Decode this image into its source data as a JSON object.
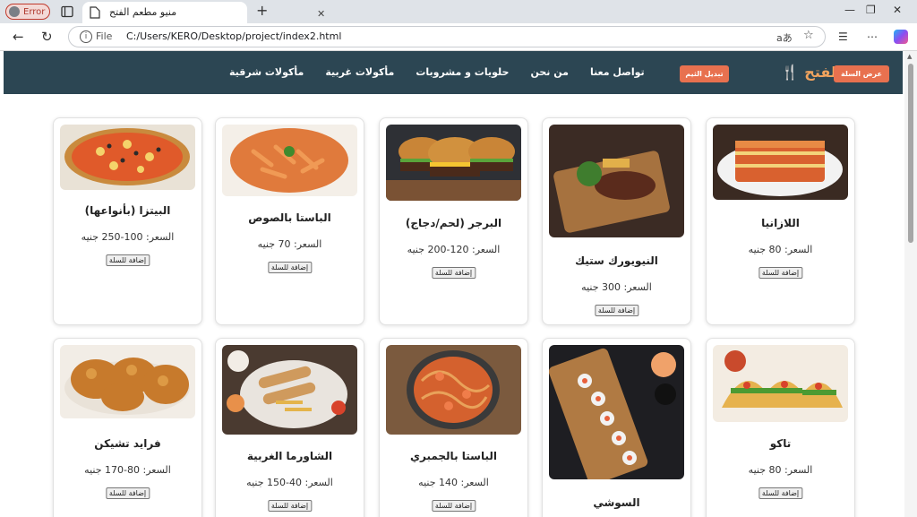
{
  "browser": {
    "profile_label": "Error",
    "tab_title": "منيو مطعم الفتح",
    "tab_close": "✕",
    "new_tab": "+",
    "file_label": "File",
    "url": "C:/Users/KERO/Desktop/project/index2.html",
    "read_aloud": "aあ"
  },
  "navbar": {
    "brand": "مطعم الفتح",
    "links": [
      "تواصل معنا",
      "من نحن",
      "حلويات و مشروبات",
      "مأكولات غربية",
      "مأكولات شرقية"
    ],
    "theme_button": "تبديل الثيم",
    "cart_button": "عرض السلة"
  },
  "menu": {
    "add_label": "إضافة للسلة",
    "items": [
      {
        "name": "اللازانيا",
        "price": "السعر: 80 جنيه"
      },
      {
        "name": "النيويورك ستيك",
        "price": "السعر: 300 جنيه"
      },
      {
        "name": "البرجر (لحم/دجاج)",
        "price": "السعر: 120-200 جنيه"
      },
      {
        "name": "الباستا بالصوص",
        "price": "السعر: 70 جنيه"
      },
      {
        "name": "البيتزا (بأنواعها)",
        "price": "السعر: 100-250 جنيه"
      },
      {
        "name": "تاكو",
        "price": "السعر: 80 جنيه"
      },
      {
        "name": "السوشي",
        "price": ""
      },
      {
        "name": "الباستا بالجمبري",
        "price": "السعر: 140 جنيه"
      },
      {
        "name": "الشاورما الغربية",
        "price": "السعر: 40-150 جنيه"
      },
      {
        "name": "فرايد تشيكن",
        "price": "السعر: 80-170 جنيه"
      }
    ]
  },
  "colors": {
    "navbar": "#2c4653",
    "accent": "#e8714f",
    "brand": "#f0a35e"
  }
}
